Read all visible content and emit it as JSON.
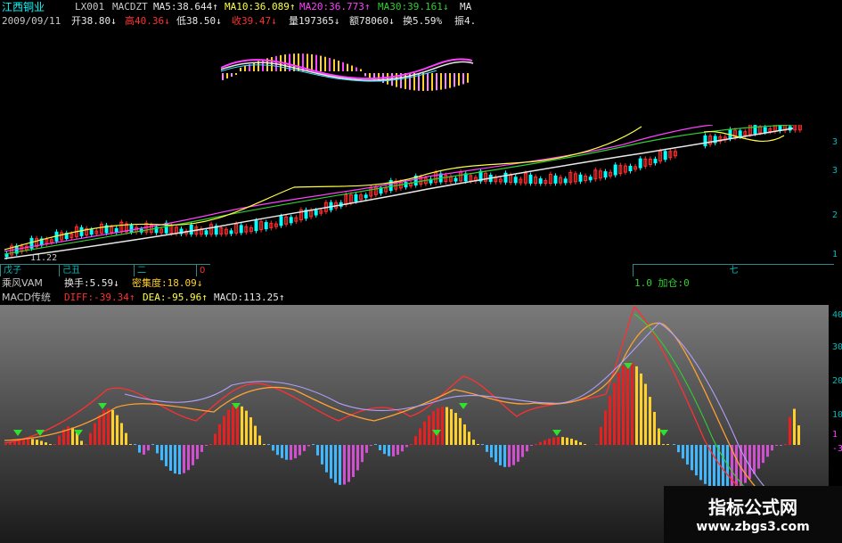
{
  "header": {
    "stock_name": "江西铜业",
    "code": "LX001",
    "indicator": "MACDZT",
    "ma5": "MA5:38.644↑",
    "ma10": "MA10:36.089↑",
    "ma20": "MA20:36.773↑",
    "ma30": "MA30:39.161↓",
    "ma_more": "MA",
    "date": "2009/09/11",
    "open": "开38.80↓",
    "high": "高40.36↓",
    "low": "低38.50↓",
    "close": "收39.47↓",
    "volume": "量197365↓",
    "amount": "额78060↓",
    "turnover": "换5.59%",
    "amplitude": "振4."
  },
  "price_pane": {
    "low_label": "11.22",
    "right_axis_ticks": [
      "3",
      "3",
      "2",
      "1"
    ]
  },
  "date_bar": {
    "segments": [
      "戊子",
      "己丑",
      "二",
      "0"
    ],
    "right_segment": "七"
  },
  "info_bar": {
    "indicator_name": "乘风VAM",
    "turnover": "换手:5.59↓",
    "density": "密集度:18.09↓",
    "right_text": "1.0 加仓:0"
  },
  "macd_bar": {
    "name": "MACD传统",
    "diff": "DIFF:-39.34↑",
    "dea": "DEA:-95.96↑",
    "macd": "MACD:113.25↑"
  },
  "macd_axis_ticks": [
    "40",
    "30",
    "20",
    "10",
    "1",
    "-3"
  ],
  "watermark": {
    "title": "指标公式网",
    "url": "www.zbgs3.com"
  },
  "colors": {
    "up": "#ff3030",
    "down": "#00ffff",
    "macd_up_red": "#e82020",
    "macd_up_yellow": "#ffd02a",
    "macd_down_blue": "#40b8ff",
    "macd_down_magenta": "#d050d0",
    "ma_white": "#e8e8e8",
    "ma_yellow": "#ffff40",
    "ma_magenta": "#ff40ff",
    "ma_green": "#30d030"
  }
}
